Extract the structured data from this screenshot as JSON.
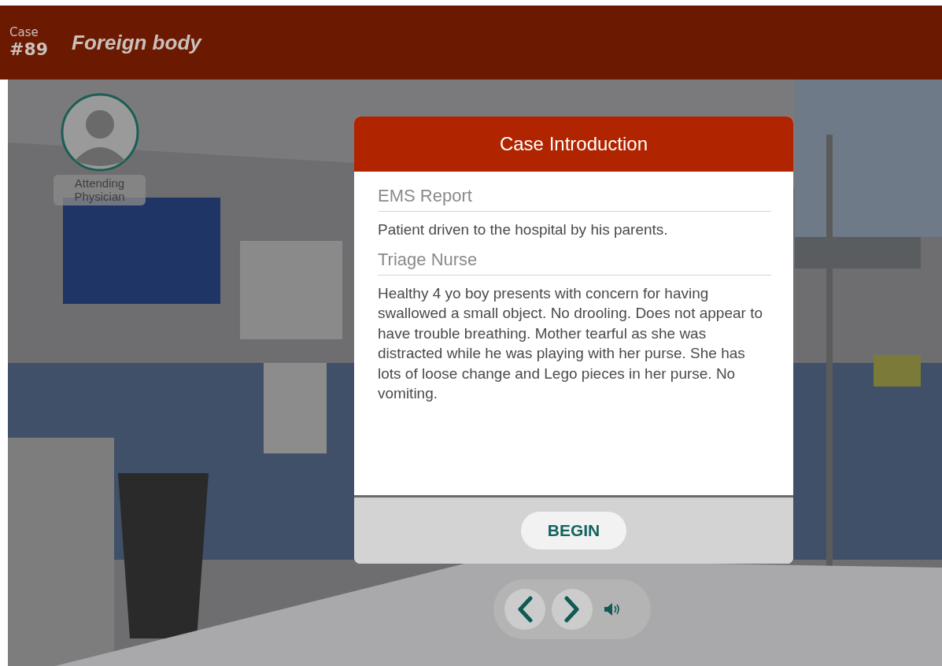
{
  "header": {
    "case_label": "Case",
    "case_number": "#89",
    "title": "Foreign body"
  },
  "guide": {
    "role": "Attending Physician"
  },
  "modal": {
    "title": "Case Introduction",
    "sections": [
      {
        "heading": "EMS Report",
        "text": "Patient driven to the hospital by his parents."
      },
      {
        "heading": "Triage Nurse",
        "text": "Healthy 4 yo boy presents with concern for having swallowed a small object. No drooling. Does not appear to have trouble breathing. Mother tearful as she was distracted while he was playing with her purse. She has lots of loose change and Lego pieces in her purse. No vomiting."
      }
    ],
    "button": "BEGIN"
  }
}
